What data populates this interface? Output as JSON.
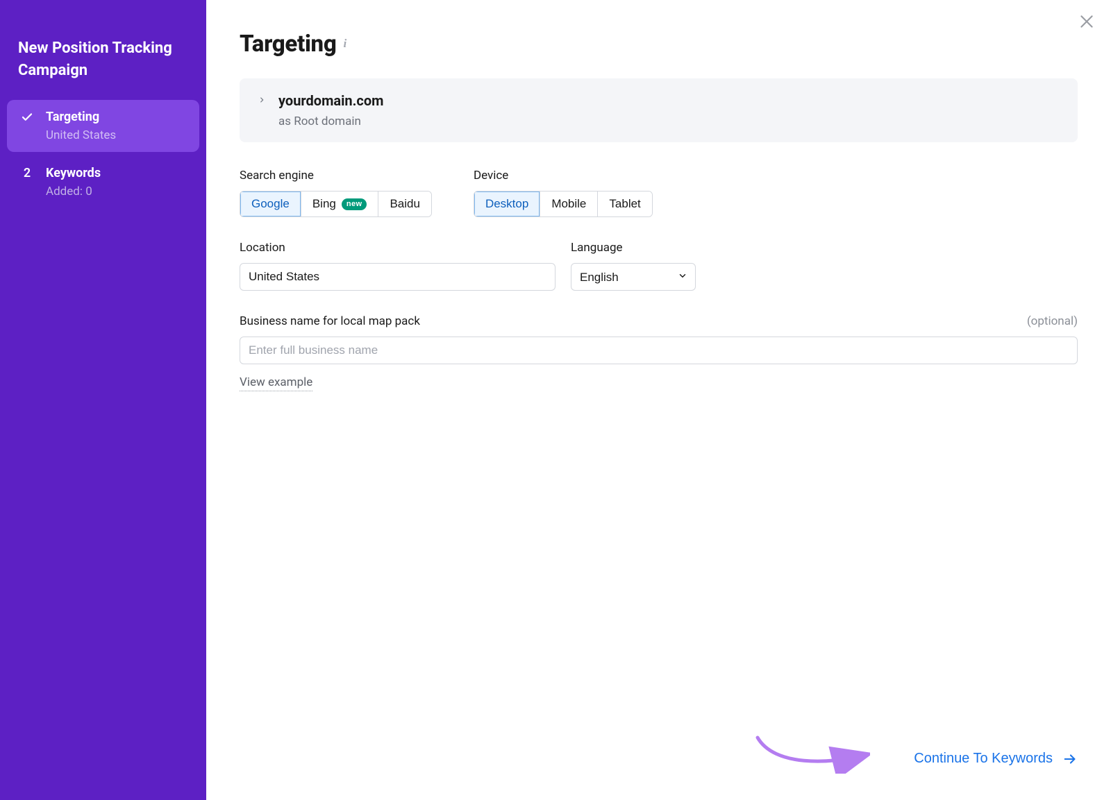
{
  "sidebar": {
    "title": "New Position Tracking Campaign",
    "steps": [
      {
        "title": "Targeting",
        "sub": "United States",
        "active": true,
        "completed": true
      },
      {
        "number": "2",
        "title": "Keywords",
        "sub": "Added: 0",
        "active": false
      }
    ]
  },
  "page": {
    "title": "Targeting"
  },
  "domain_card": {
    "domain": "yourdomain.com",
    "subtitle": "as Root domain"
  },
  "search_engine": {
    "label": "Search engine",
    "options": [
      {
        "label": "Google",
        "selected": true
      },
      {
        "label": "Bing",
        "selected": false,
        "badge": "new"
      },
      {
        "label": "Baidu",
        "selected": false
      }
    ]
  },
  "device": {
    "label": "Device",
    "options": [
      {
        "label": "Desktop",
        "selected": true
      },
      {
        "label": "Mobile",
        "selected": false
      },
      {
        "label": "Tablet",
        "selected": false
      }
    ]
  },
  "location": {
    "label": "Location",
    "value": "United States"
  },
  "language": {
    "label": "Language",
    "value": "English"
  },
  "business": {
    "label": "Business name for local map pack",
    "optional_text": "(optional)",
    "placeholder": "Enter full business name",
    "view_example": "View example"
  },
  "footer": {
    "continue_label": "Continue To Keywords"
  }
}
